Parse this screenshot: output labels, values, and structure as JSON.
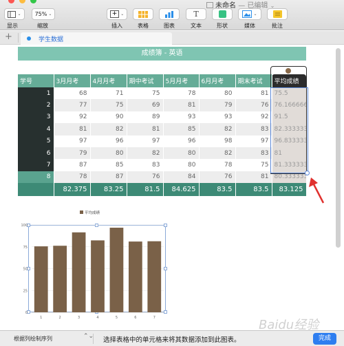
{
  "window": {
    "title": "未命名",
    "subtitle": "— 已编辑",
    "subtitle_caret": "⌄"
  },
  "toolbar": {
    "display_label": "显示",
    "zoom_value": "75%",
    "zoom_label": "缩放",
    "insert_label": "插入",
    "table_label": "表格",
    "chart_label": "图表",
    "text_label": "文本",
    "text_icon_glyph": "T",
    "shape_label": "形状",
    "media_label": "媒体",
    "comment_label": "批注",
    "caret_glyph": "⌄",
    "add_glyph": "+"
  },
  "tabs": {
    "add_glyph": "+",
    "sheet_name": "学生数据"
  },
  "table": {
    "title": "成绩簿 - 英语",
    "headers": [
      "学号",
      "3月月考",
      "4月月考",
      "期中考试",
      "5月月考",
      "6月月考",
      "期末考试",
      "平均成绩"
    ],
    "rows": [
      [
        "1",
        "68",
        "71",
        "75",
        "78",
        "80",
        "81",
        "75.5"
      ],
      [
        "2",
        "77",
        "75",
        "69",
        "81",
        "79",
        "76",
        "76.1666666"
      ],
      [
        "3",
        "92",
        "90",
        "89",
        "93",
        "93",
        "92",
        "91.5"
      ],
      [
        "4",
        "81",
        "82",
        "81",
        "85",
        "82",
        "83",
        "82.3333333"
      ],
      [
        "5",
        "97",
        "96",
        "97",
        "96",
        "98",
        "97",
        "96.8333333"
      ],
      [
        "6",
        "79",
        "80",
        "82",
        "80",
        "82",
        "83",
        "81"
      ],
      [
        "7",
        "87",
        "85",
        "83",
        "80",
        "78",
        "75",
        "81.3333333"
      ],
      [
        "8",
        "78",
        "87",
        "76",
        "84",
        "76",
        "81",
        "80.3333333"
      ]
    ],
    "footer": [
      "",
      "82.375",
      "83.25",
      "81.5",
      "84.625",
      "83.5",
      "83.5",
      "83.125"
    ]
  },
  "chart_data": {
    "type": "bar",
    "legend": [
      "平均成绩"
    ],
    "legend_placement": "top-center",
    "categories": [
      "1",
      "2",
      "3",
      "4",
      "5",
      "6",
      "7"
    ],
    "series": [
      {
        "name": "平均成绩",
        "values": [
          75.5,
          76.17,
          91.5,
          82.33,
          96.83,
          81,
          81.33
        ]
      }
    ],
    "y_ticks": [
      "0",
      "25",
      "50",
      "75",
      "100"
    ],
    "ylim": [
      0,
      100
    ],
    "grid": true,
    "bar_color": "#7a6148"
  },
  "bottom": {
    "plot_mode": "根据列绘制序列",
    "chevron_glyph": "⌃⌄",
    "message": "选择表格中的单元格来将其数据添加到此图表。",
    "done_label": "完成"
  },
  "watermark": "Baidu经验",
  "colors": {
    "accent": "#2e7ef0",
    "table_header": "#65ac97",
    "title_bar": "#7fc5b2",
    "footer": "#3d8a76",
    "arrow": "#e0312e"
  }
}
